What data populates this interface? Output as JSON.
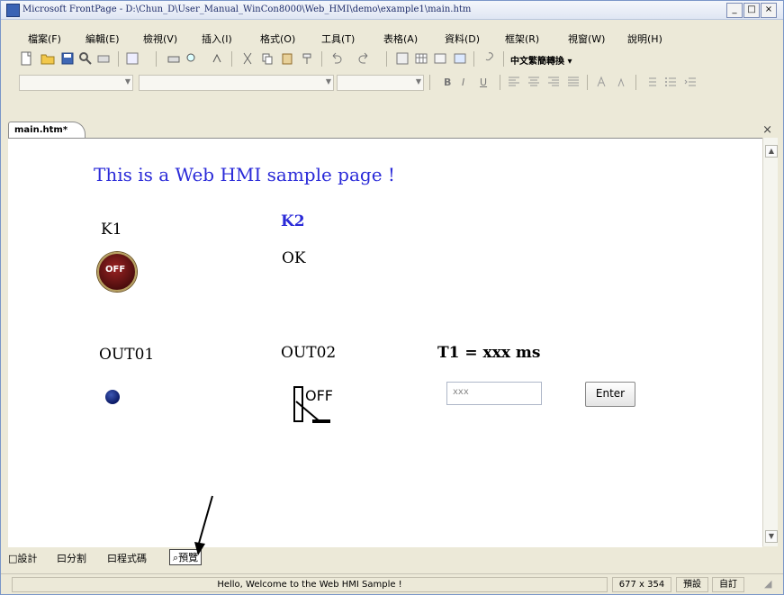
{
  "window": {
    "title": "Microsoft FrontPage - D:\\Chun_D\\User_Manual_WinCon8000\\Web_HMI\\demo\\example1\\main.htm",
    "title_controls": [
      "_",
      "□",
      "×"
    ]
  },
  "menu": [
    "檔案(F)",
    "編輯(E)",
    "檢視(V)",
    "插入(I)",
    "格式(O)",
    "工具(T)",
    "表格(A)",
    "資料(D)",
    "框架(R)",
    "視窗(W)",
    "說明(H)"
  ],
  "toolbar": {
    "language_button": "中文繁簡轉換 ▾"
  },
  "format": {
    "bold": "B",
    "italic": "I",
    "underline": "U"
  },
  "document": {
    "tab": "main.htm*",
    "close": "×"
  },
  "page": {
    "title": "This is a Web HMI sample page !",
    "k1": "K1",
    "k2": "K2",
    "ok": "OK",
    "off_button": "OFF",
    "out01": "OUT01",
    "out02": "OUT02",
    "t1": "T1 = xxx ms",
    "switch_label": "OFF",
    "input_value": "xxx",
    "enter": "Enter"
  },
  "view_tabs": [
    "□設計",
    "曰分割",
    "曰程式碼",
    "預覽"
  ],
  "status": {
    "message": "Hello, Welcome to the Web HMI Sample !",
    "size": "677 x 354",
    "default": "預設",
    "custom": "自訂"
  },
  "colors": {
    "title_blue": "#2a2ad8",
    "window_bg": "#ece9d8"
  }
}
